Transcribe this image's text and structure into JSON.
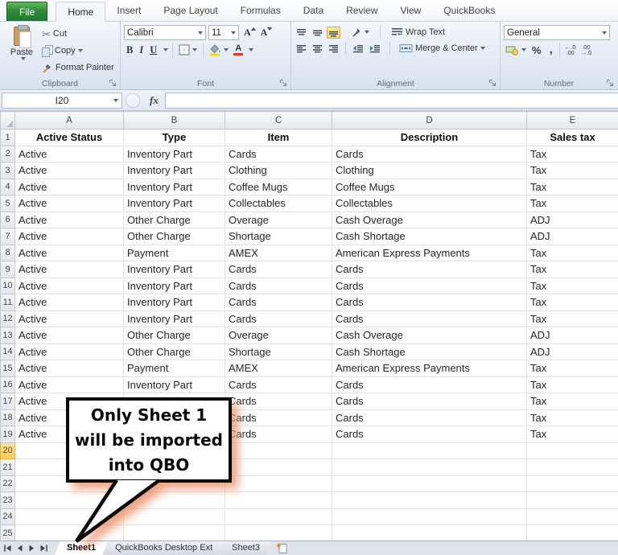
{
  "ribbon": {
    "file_tab": "File",
    "tabs": [
      "Home",
      "Insert",
      "Page Layout",
      "Formulas",
      "Data",
      "Review",
      "View",
      "QuickBooks"
    ],
    "active_tab": "Home",
    "clipboard": {
      "label": "Clipboard",
      "paste": "Paste",
      "cut": "Cut",
      "copy": "Copy",
      "format_painter": "Format Painter"
    },
    "font": {
      "label": "Font",
      "font_name": "Calibri",
      "font_size": "11",
      "bold": "B",
      "italic": "I",
      "underline": "U",
      "grow_font": "A",
      "shrink_font": "A",
      "color_letter": "A",
      "fill_color": "#ffd900",
      "font_color": "#da3a27"
    },
    "alignment": {
      "label": "Alignment",
      "wrap_text": "Wrap Text",
      "merge_center": "Merge & Center"
    },
    "number": {
      "label": "Number",
      "format": "General",
      "percent": "%",
      "comma": ",",
      "inc_decimal_top": "←.0",
      "inc_decimal_bottom": ".00",
      "dec_decimal_top": ".00",
      "dec_decimal_bottom": "→.0"
    }
  },
  "formula_bar": {
    "name_box": "I20",
    "fx": "fx",
    "value": ""
  },
  "grid": {
    "columns": [
      "A",
      "B",
      "C",
      "D",
      "E"
    ],
    "header_row": [
      "Active Status",
      "Type",
      "Item",
      "Description",
      "Sales tax"
    ],
    "rows": [
      [
        "Active",
        "Inventory Part",
        "Cards",
        "Cards",
        "Tax"
      ],
      [
        "Active",
        "Inventory Part",
        "Clothing",
        "Clothing",
        "Tax"
      ],
      [
        "Active",
        "Inventory Part",
        "Coffee Mugs",
        "Coffee Mugs",
        "Tax"
      ],
      [
        "Active",
        "Inventory Part",
        "Collectables",
        "Collectables",
        "Tax"
      ],
      [
        "Active",
        "Other Charge",
        "Overage",
        "Cash Overage",
        "ADJ"
      ],
      [
        "Active",
        "Other Charge",
        "Shortage",
        "Cash Shortage",
        "ADJ"
      ],
      [
        "Active",
        "Payment",
        "AMEX",
        "American Express Payments",
        "Tax"
      ],
      [
        "Active",
        "Inventory Part",
        "Cards",
        "Cards",
        "Tax"
      ],
      [
        "Active",
        "Inventory Part",
        "Cards",
        "Cards",
        "Tax"
      ],
      [
        "Active",
        "Inventory Part",
        "Cards",
        "Cards",
        "Tax"
      ],
      [
        "Active",
        "Inventory Part",
        "Cards",
        "Cards",
        "Tax"
      ],
      [
        "Active",
        "Other Charge",
        "Overage",
        "Cash Overage",
        "ADJ"
      ],
      [
        "Active",
        "Other Charge",
        "Shortage",
        "Cash Shortage",
        "ADJ"
      ],
      [
        "Active",
        "Payment",
        "AMEX",
        "American Express Payments",
        "Tax"
      ],
      [
        "Active",
        "Inventory Part",
        "Cards",
        "Cards",
        "Tax"
      ],
      [
        "Active",
        "",
        "Cards",
        "Cards",
        "Tax"
      ],
      [
        "Active",
        "",
        "Cards",
        "Cards",
        "Tax"
      ],
      [
        "Active",
        "",
        "Cards",
        "Cards",
        "Tax"
      ]
    ],
    "empty_rows": [
      20,
      21,
      22,
      23,
      24,
      25
    ],
    "highlighted_row": 20
  },
  "callout": {
    "lines": [
      "Only Sheet 1",
      "will be imported",
      "into QBO"
    ],
    "shadow_color": "#e98c60"
  },
  "sheet_bar": {
    "tabs": [
      "Sheet1",
      "QuickBooks Desktop Ext",
      "Sheet3"
    ],
    "active_tab": "Sheet1"
  }
}
